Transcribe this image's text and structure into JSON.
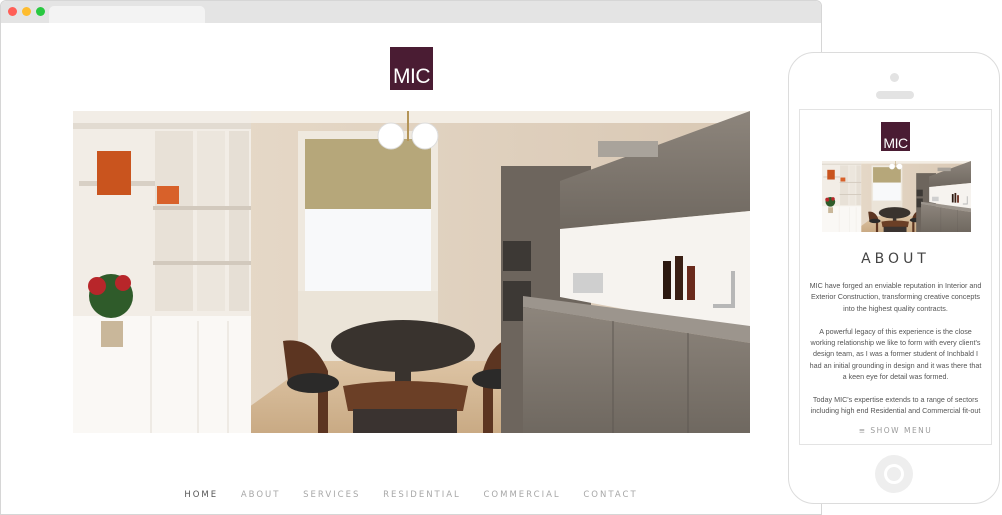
{
  "desktop": {
    "logo_text": "MIC",
    "hero_image": "kitchen-interior-photo",
    "nav": {
      "items": [
        "HOME",
        "ABOUT",
        "SERVICES",
        "RESIDENTIAL",
        "COMMERCIAL",
        "CONTACT"
      ],
      "active": "HOME"
    }
  },
  "mobile": {
    "logo_text": "MIC",
    "hero_image": "kitchen-interior-photo",
    "section_title": "ABOUT",
    "paragraphs": [
      "MIC have forged an enviable reputation in Interior and Exterior Construction, transforming creative concepts into the highest quality contracts.",
      "A powerful legacy of this experience is the close working relationship we like to form with every client's design team, as I was a former student of Inchbald I had an initial grounding in design and it was there that a keen eye for detail was formed.",
      "Today MIC's expertise extends to a range of sectors including high end Residential and Commercial fit-out"
    ],
    "menu_label": "≡ SHOW MENU"
  },
  "colors": {
    "brand": "#4a1c33",
    "nav_active": "#555555",
    "nav_inactive": "#a7a7a7"
  }
}
